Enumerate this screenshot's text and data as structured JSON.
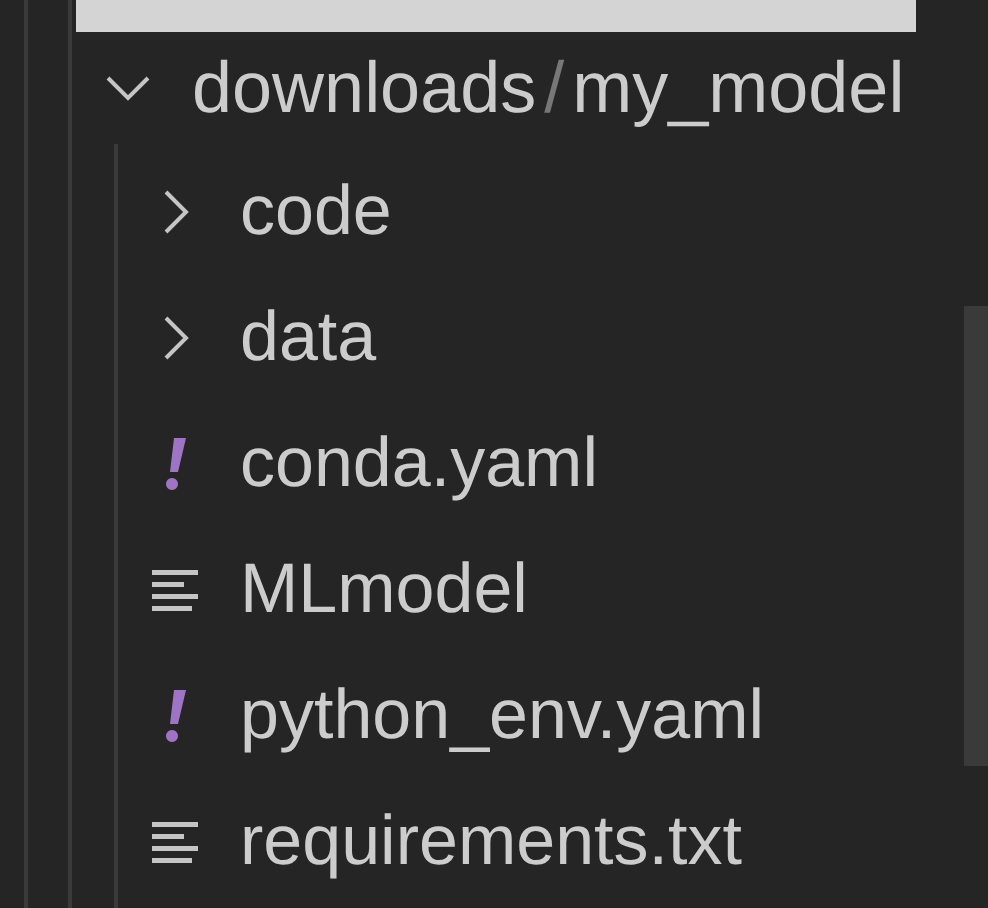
{
  "tree": {
    "path": [
      "downloads",
      "my_model"
    ],
    "separator": "/",
    "expanded": true,
    "children": [
      {
        "name": "code",
        "kind": "folder",
        "expanded": false
      },
      {
        "name": "data",
        "kind": "folder",
        "expanded": false
      },
      {
        "name": "conda.yaml",
        "kind": "yaml"
      },
      {
        "name": "MLmodel",
        "kind": "text"
      },
      {
        "name": "python_env.yaml",
        "kind": "yaml"
      },
      {
        "name": "requirements.txt",
        "kind": "text"
      }
    ]
  }
}
